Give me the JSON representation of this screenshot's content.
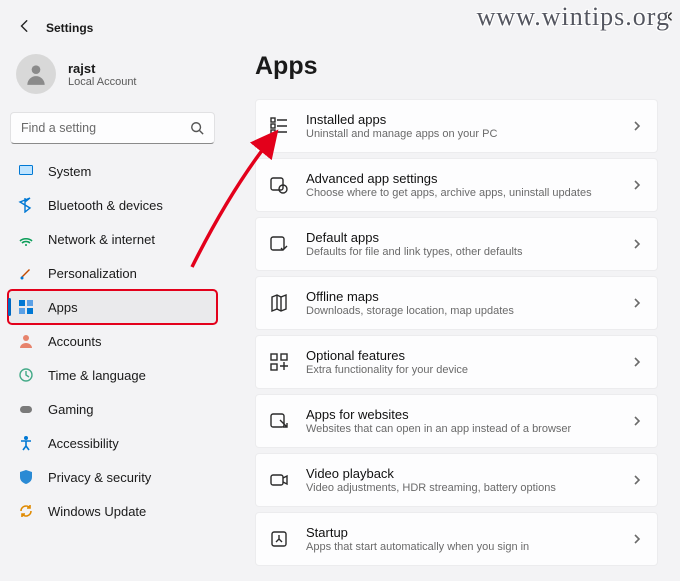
{
  "watermark": "www.wintips.org",
  "window_title": "Settings",
  "user": {
    "name": "rajst",
    "subtitle": "Local Account"
  },
  "search": {
    "placeholder": "Find a setting"
  },
  "sidebar": {
    "items": [
      {
        "label": "System"
      },
      {
        "label": "Bluetooth & devices"
      },
      {
        "label": "Network & internet"
      },
      {
        "label": "Personalization"
      },
      {
        "label": "Apps"
      },
      {
        "label": "Accounts"
      },
      {
        "label": "Time & language"
      },
      {
        "label": "Gaming"
      },
      {
        "label": "Accessibility"
      },
      {
        "label": "Privacy & security"
      },
      {
        "label": "Windows Update"
      }
    ],
    "active_index": 4
  },
  "main": {
    "title": "Apps",
    "cards": [
      {
        "title": "Installed apps",
        "sub": "Uninstall and manage apps on your PC"
      },
      {
        "title": "Advanced app settings",
        "sub": "Choose where to get apps, archive apps, uninstall updates"
      },
      {
        "title": "Default apps",
        "sub": "Defaults for file and link types, other defaults"
      },
      {
        "title": "Offline maps",
        "sub": "Downloads, storage location, map updates"
      },
      {
        "title": "Optional features",
        "sub": "Extra functionality for your device"
      },
      {
        "title": "Apps for websites",
        "sub": "Websites that can open in an app instead of a browser"
      },
      {
        "title": "Video playback",
        "sub": "Video adjustments, HDR streaming, battery options"
      },
      {
        "title": "Startup",
        "sub": "Apps that start automatically when you sign in"
      }
    ]
  }
}
